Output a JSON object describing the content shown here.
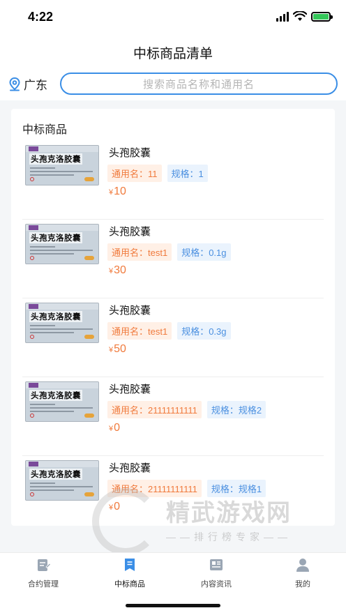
{
  "status_bar": {
    "time": "4:22"
  },
  "header": {
    "title": "中标商品清单",
    "location": "广东",
    "search_placeholder": "搜索商品名称和通用名"
  },
  "section": {
    "title": "中标商品"
  },
  "products": [
    {
      "name": "头孢胶囊",
      "generic": "通用名：11",
      "spec": "规格：1",
      "currency": "¥",
      "price": "10",
      "box_label": "头孢克洛胶囊"
    },
    {
      "name": "头孢胶囊",
      "generic": "通用名：test1",
      "spec": "规格：0.1g",
      "currency": "¥",
      "price": "30",
      "box_label": "头孢克洛胶囊"
    },
    {
      "name": "头孢胶囊",
      "generic": "通用名：test1",
      "spec": "规格：0.3g",
      "currency": "¥",
      "price": "50",
      "box_label": "头孢克洛胶囊"
    },
    {
      "name": "头孢胶囊",
      "generic": "通用名：21111111111",
      "spec": "规格：规格2",
      "currency": "¥",
      "price": "0",
      "box_label": "头孢克洛胶囊"
    },
    {
      "name": "头孢胶囊",
      "generic": "通用名：21111111111",
      "spec": "规格：规格1",
      "currency": "¥",
      "price": "0",
      "box_label": "头孢克洛胶囊"
    }
  ],
  "watermark": {
    "text": "精武游戏网",
    "sub": "——排行榜专家——"
  },
  "tabbar": {
    "items": [
      {
        "label": "合约管理",
        "icon": "contract-icon"
      },
      {
        "label": "中标商品",
        "icon": "bookmark-icon",
        "active": true
      },
      {
        "label": "内容资讯",
        "icon": "news-icon"
      },
      {
        "label": "我的",
        "icon": "person-icon"
      }
    ]
  },
  "colors": {
    "accent": "#3a8ee6",
    "price": "#f07a3c",
    "generic_tag_bg": "#fff0e6",
    "spec_tag_bg": "#eaf3fd",
    "active_tab": "#3a8ee6",
    "inactive_tab": "#9aa6b4"
  }
}
